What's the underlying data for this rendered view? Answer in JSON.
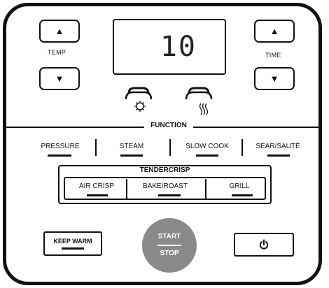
{
  "temp": {
    "label": "TEMP",
    "up_icon": "up-arrow",
    "down_icon": "down-arrow"
  },
  "time": {
    "label": "TIME",
    "up_icon": "up-arrow",
    "down_icon": "down-arrow"
  },
  "display": {
    "value": "10"
  },
  "modes": [
    {
      "icon": "pressure-lid-icon",
      "glyph": "☼"
    },
    {
      "icon": "steam-lid-icon",
      "glyph": "))"
    }
  ],
  "function": {
    "label": "FUNCTION",
    "items": [
      "PRESSURE",
      "STEAM",
      "SLOW COOK",
      "SEAR/SAUTÉ"
    ]
  },
  "tendercrisp": {
    "label": "TENDERCRISP",
    "items": [
      "AIR CRISP",
      "BAKE/ROAST",
      "GRILL"
    ]
  },
  "keep_warm": {
    "label": "KEEP WARM"
  },
  "start_stop": {
    "start": "START",
    "stop": "STOP"
  },
  "power": {
    "icon": "power-icon",
    "glyph": "⏻"
  }
}
